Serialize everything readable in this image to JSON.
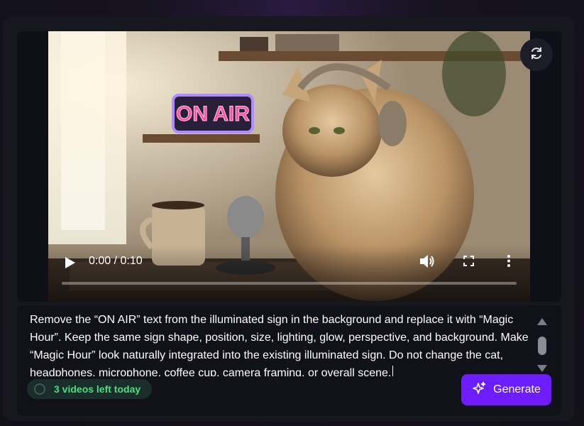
{
  "video": {
    "time_display": "0:00 / 0:10",
    "progress_fraction": 0,
    "sign_text": "ON AIR"
  },
  "prompt": {
    "text": "Remove the “ON AIR” text from the illuminated sign in the background and replace it with “Magic Hour”. Keep the same sign shape, position, size, lighting, glow, perspective, and background. Make “Magic Hour” look naturally integrated into the existing illuminated sign. Do not change the cat, headphones, microphone, coffee cup, camera framing, or overall scene."
  },
  "quota": {
    "label": "3 videos left today"
  },
  "actions": {
    "generate_label": "Generate"
  },
  "colors": {
    "accent": "#6d1bff",
    "quota_text": "#4ade80",
    "sign_pink": "#ff4fa3",
    "sign_blue": "#8ad8ff"
  },
  "icons": {
    "reload": "refresh-icon",
    "play": "play-icon",
    "volume": "volume-icon",
    "fullscreen": "fullscreen-icon",
    "more": "more-options-icon",
    "generate": "sparkles-icon"
  }
}
